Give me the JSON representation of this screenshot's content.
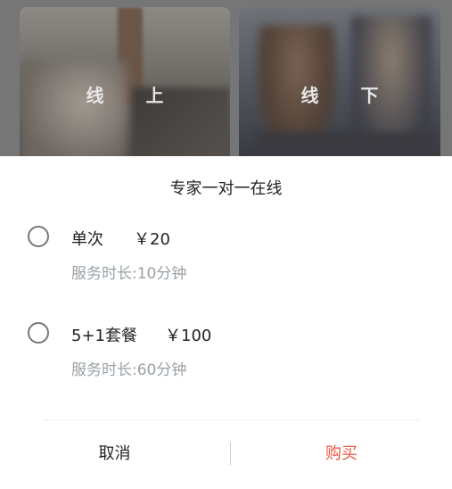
{
  "background": {
    "cards": [
      {
        "label": "线 上"
      },
      {
        "label": "线 下"
      }
    ]
  },
  "dialog": {
    "title": "专家一对一在线",
    "options": [
      {
        "name": "单次",
        "price": "￥20",
        "duration": "服务时长:10分钟"
      },
      {
        "name": "5+1套餐",
        "price": "￥100",
        "duration": "服务时长:60分钟"
      }
    ],
    "cancel_label": "取消",
    "buy_label": "购买"
  },
  "colors": {
    "accent": "#e8553d",
    "muted_text": "#9aa1a6",
    "overlay": "#767676"
  }
}
